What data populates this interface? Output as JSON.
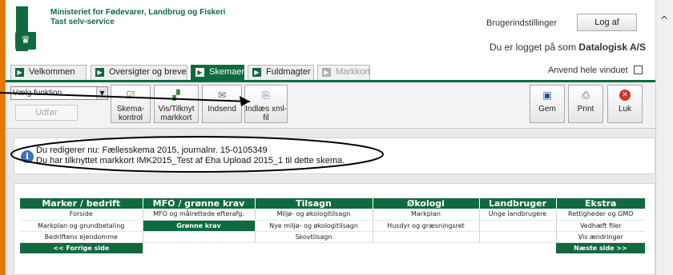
{
  "header": {
    "ministry_line1": "Ministeriet for Fødevarer, Landbrug og Fiskeri",
    "ministry_line2": "Tast selv-service",
    "user_settings": "Brugerindstillinger",
    "logout": "Log af",
    "logged_in_prefix": "Du er logget på som",
    "logged_in_user": "Datalogisk A/S"
  },
  "tabs": [
    {
      "label": "Velkommen"
    },
    {
      "label": "Oversigter og breve"
    },
    {
      "label": "Skemaer"
    },
    {
      "label": "Fuldmagter"
    },
    {
      "label": "Markkort"
    }
  ],
  "fullwindow_label": "Anvend hele vinduet",
  "toolbar": {
    "select_value": "Vælg funktion",
    "execute": "Udfør",
    "buttons": [
      {
        "line1": "Skema-",
        "line2": "kontrol"
      },
      {
        "line1": "Vis/Tilknyt",
        "line2": "markkort"
      },
      {
        "line1": "Indsend",
        "line2": ""
      },
      {
        "line1": "Indlæs xml-",
        "line2": "fil"
      }
    ],
    "save": "Gem",
    "print": "Print",
    "close": "Luk"
  },
  "info": {
    "line1": "Du redigerer nu: Fællesskema 2015, journalnr. 15-0105349",
    "line2": "Du har tilknyttet markkort IMK2015_Test af Eha Upload 2015_1 til dette skema."
  },
  "nav": {
    "headers": [
      "Marker / bedrift",
      "MFO / grønne krav",
      "Tilsagn",
      "Økologi",
      "Landbruger",
      "Ekstra"
    ],
    "rows": [
      [
        "Forside",
        "MFO og målrettede efterafg.",
        "Miljø- og økologitilsagn",
        "Markplan",
        "Unge landbrugere",
        "Rettigheder og GMO"
      ],
      [
        "Markplan og grundbetaling",
        "Grønne krav",
        "Nye miljø- og økologitilsagn",
        "Husdyr og græsningsret",
        "",
        "Vedhæft filer"
      ],
      [
        "Bedriftens ejendomme",
        "",
        "Skovtilsagn",
        "",
        "",
        "Vis ændringer"
      ]
    ],
    "prev": "<< Forrige side",
    "next": "Næste side >>"
  },
  "colors": {
    "brand_green": "#0f6b3f",
    "edge_orange": "#e87700"
  }
}
